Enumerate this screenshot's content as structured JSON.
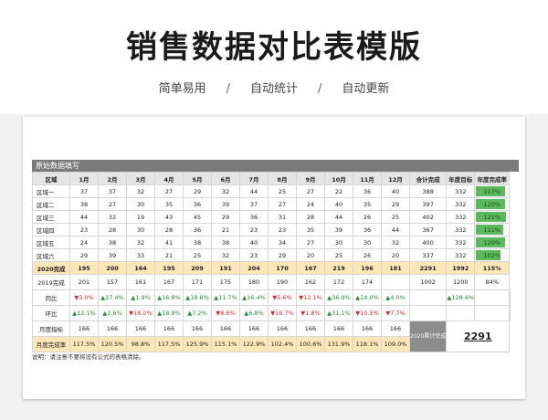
{
  "header": {
    "title": "销售数据对比表模版",
    "tags": [
      "简单易用",
      "自动统计",
      "自动更新"
    ],
    "sep": "/"
  },
  "sheet": {
    "banner": "原始数据填写",
    "columns": [
      "区域",
      "1月",
      "2月",
      "3月",
      "4月",
      "5月",
      "6月",
      "7月",
      "8月",
      "9月",
      "10月",
      "11月",
      "12月",
      "合计完成",
      "年度目标",
      "年度完成率"
    ],
    "regions": [
      {
        "name": "区域一",
        "months": [
          "37",
          "37",
          "32",
          "27",
          "29",
          "32",
          "44",
          "25",
          "27",
          "22",
          "36",
          "40"
        ],
        "total": "388",
        "target": "332",
        "rate": "117%",
        "rate_value": 1.17
      },
      {
        "name": "区域二",
        "months": [
          "38",
          "27",
          "30",
          "35",
          "36",
          "39",
          "37",
          "27",
          "24",
          "40",
          "35",
          "29"
        ],
        "total": "397",
        "target": "332",
        "rate": "120%",
        "rate_value": 1.2
      },
      {
        "name": "区域三",
        "months": [
          "44",
          "32",
          "19",
          "43",
          "45",
          "29",
          "36",
          "31",
          "28",
          "44",
          "26",
          "25"
        ],
        "total": "402",
        "target": "332",
        "rate": "121%",
        "rate_value": 1.21
      },
      {
        "name": "区域四",
        "months": [
          "23",
          "28",
          "30",
          "28",
          "36",
          "21",
          "23",
          "23",
          "35",
          "39",
          "36",
          "44"
        ],
        "total": "367",
        "target": "332",
        "rate": "111%",
        "rate_value": 1.11
      },
      {
        "name": "区域五",
        "months": [
          "24",
          "38",
          "32",
          "41",
          "38",
          "38",
          "40",
          "34",
          "27",
          "30",
          "30",
          "32"
        ],
        "total": "400",
        "target": "332",
        "rate": "120%",
        "rate_value": 1.2
      },
      {
        "name": "区域六",
        "months": [
          "29",
          "39",
          "33",
          "21",
          "25",
          "32",
          "23",
          "29",
          "20",
          "25",
          "26",
          "20"
        ],
        "total": "337",
        "target": "332",
        "rate": "102%",
        "rate_value": 1.02
      }
    ],
    "total_2020": {
      "label": "2020完成",
      "months": [
        "195",
        "200",
        "164",
        "195",
        "209",
        "191",
        "204",
        "170",
        "167",
        "219",
        "196",
        "181"
      ],
      "total": "2291",
      "target": "1992",
      "rate": "115%"
    },
    "done_2019": {
      "label": "2019完成",
      "months": [
        "201",
        "157",
        "161",
        "167",
        "171",
        "175",
        "180",
        "190",
        "162",
        "172",
        "174"
      ],
      "total": "1002",
      "target": "1200",
      "rate": "84%"
    },
    "yoy": {
      "label": "同比",
      "cells": [
        {
          "dir": "down",
          "text": "3.0%"
        },
        {
          "dir": "up",
          "text": "27.4%"
        },
        {
          "dir": "up",
          "text": "1.9%"
        },
        {
          "dir": "up",
          "text": "16.8%"
        },
        {
          "dir": "up",
          "text": "18.8%"
        },
        {
          "dir": "up",
          "text": "11.7%"
        },
        {
          "dir": "up",
          "text": "16.4%"
        },
        {
          "dir": "down",
          "text": "5.6%"
        },
        {
          "dir": "down",
          "text": "12.1%"
        },
        {
          "dir": "up",
          "text": "36.9%"
        },
        {
          "dir": "up",
          "text": "14.0%"
        },
        {
          "dir": "up",
          "text": "4.0%"
        }
      ],
      "total": {
        "dir": "up",
        "text": "128.6%"
      }
    },
    "mom": {
      "label": "环比",
      "cells": [
        {
          "dir": "up",
          "text": "12.1%"
        },
        {
          "dir": "up",
          "text": "2.6%"
        },
        {
          "dir": "down",
          "text": "18.0%"
        },
        {
          "dir": "up",
          "text": "18.9%"
        },
        {
          "dir": "up",
          "text": "7.2%"
        },
        {
          "dir": "down",
          "text": "8.6%"
        },
        {
          "dir": "up",
          "text": "6.8%"
        },
        {
          "dir": "down",
          "text": "16.7%"
        },
        {
          "dir": "down",
          "text": "1.8%"
        },
        {
          "dir": "up",
          "text": "31.1%"
        },
        {
          "dir": "down",
          "text": "10.5%"
        },
        {
          "dir": "down",
          "text": "7.7%"
        }
      ]
    },
    "monthly_target": {
      "label": "月度指标",
      "months": [
        "166",
        "166",
        "166",
        "166",
        "166",
        "166",
        "166",
        "166",
        "166",
        "166",
        "166",
        "166"
      ]
    },
    "monthly_rate": {
      "label": "月度完成率",
      "months": [
        "117.5%",
        "120.5%",
        "98.8%",
        "117.5%",
        "125.9%",
        "115.1%",
        "122.9%",
        "102.4%",
        "100.6%",
        "131.9%",
        "118.1%",
        "109.0%"
      ]
    },
    "summary_label": "2020累计完成",
    "summary_value": "2291",
    "note": "说明：请注意不要将设有公式的表格清除。"
  },
  "colors": {
    "up": "#2e8b3e",
    "down": "#d03030",
    "bar": "#5cb85c",
    "highlight": "#fde7b8"
  }
}
